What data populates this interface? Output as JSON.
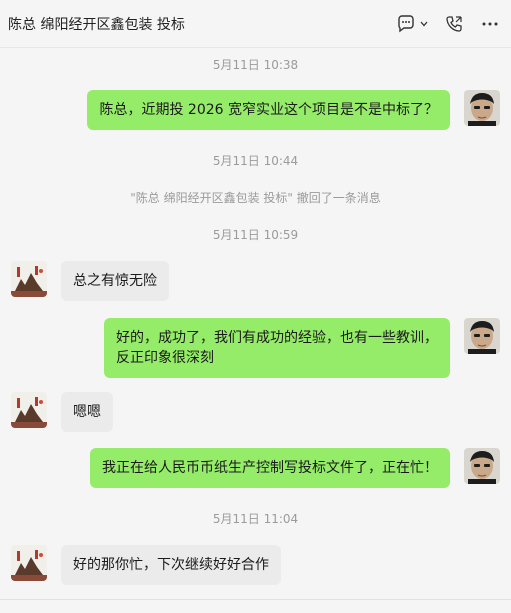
{
  "header": {
    "title": "陈总 绵阳经开区鑫包装 投标",
    "icons": [
      "chat-bubble-icon",
      "chevron-down-icon",
      "phone-icon",
      "more-icon"
    ]
  },
  "colors": {
    "me_bubble": "#95ec69",
    "them_bubble": "#ebebeb",
    "timestamp": "#9b9b9b"
  },
  "messages": {
    "ts1": "5月11日 10:38",
    "m1": "陈总，近期投 2026 宽窄实业这个项目是不是中标了？",
    "ts2": "5月11日 10:44",
    "recall": "\"陈总 绵阳经开区鑫包装 投标\" 撤回了一条消息",
    "ts3": "5月11日 10:59",
    "m2": "总之有惊无险",
    "m3_line1": "好的，成功了，我们有成功的经验，也有一些教训，",
    "m3_line2": "反正印象很深刻",
    "m4": "嗯嗯",
    "m5": "我正在给人民币币纸生产控制写投标文件了，正在忙！",
    "ts4": "5月11日 11:04",
    "m6": "好的那你忙，下次继续好好合作"
  }
}
